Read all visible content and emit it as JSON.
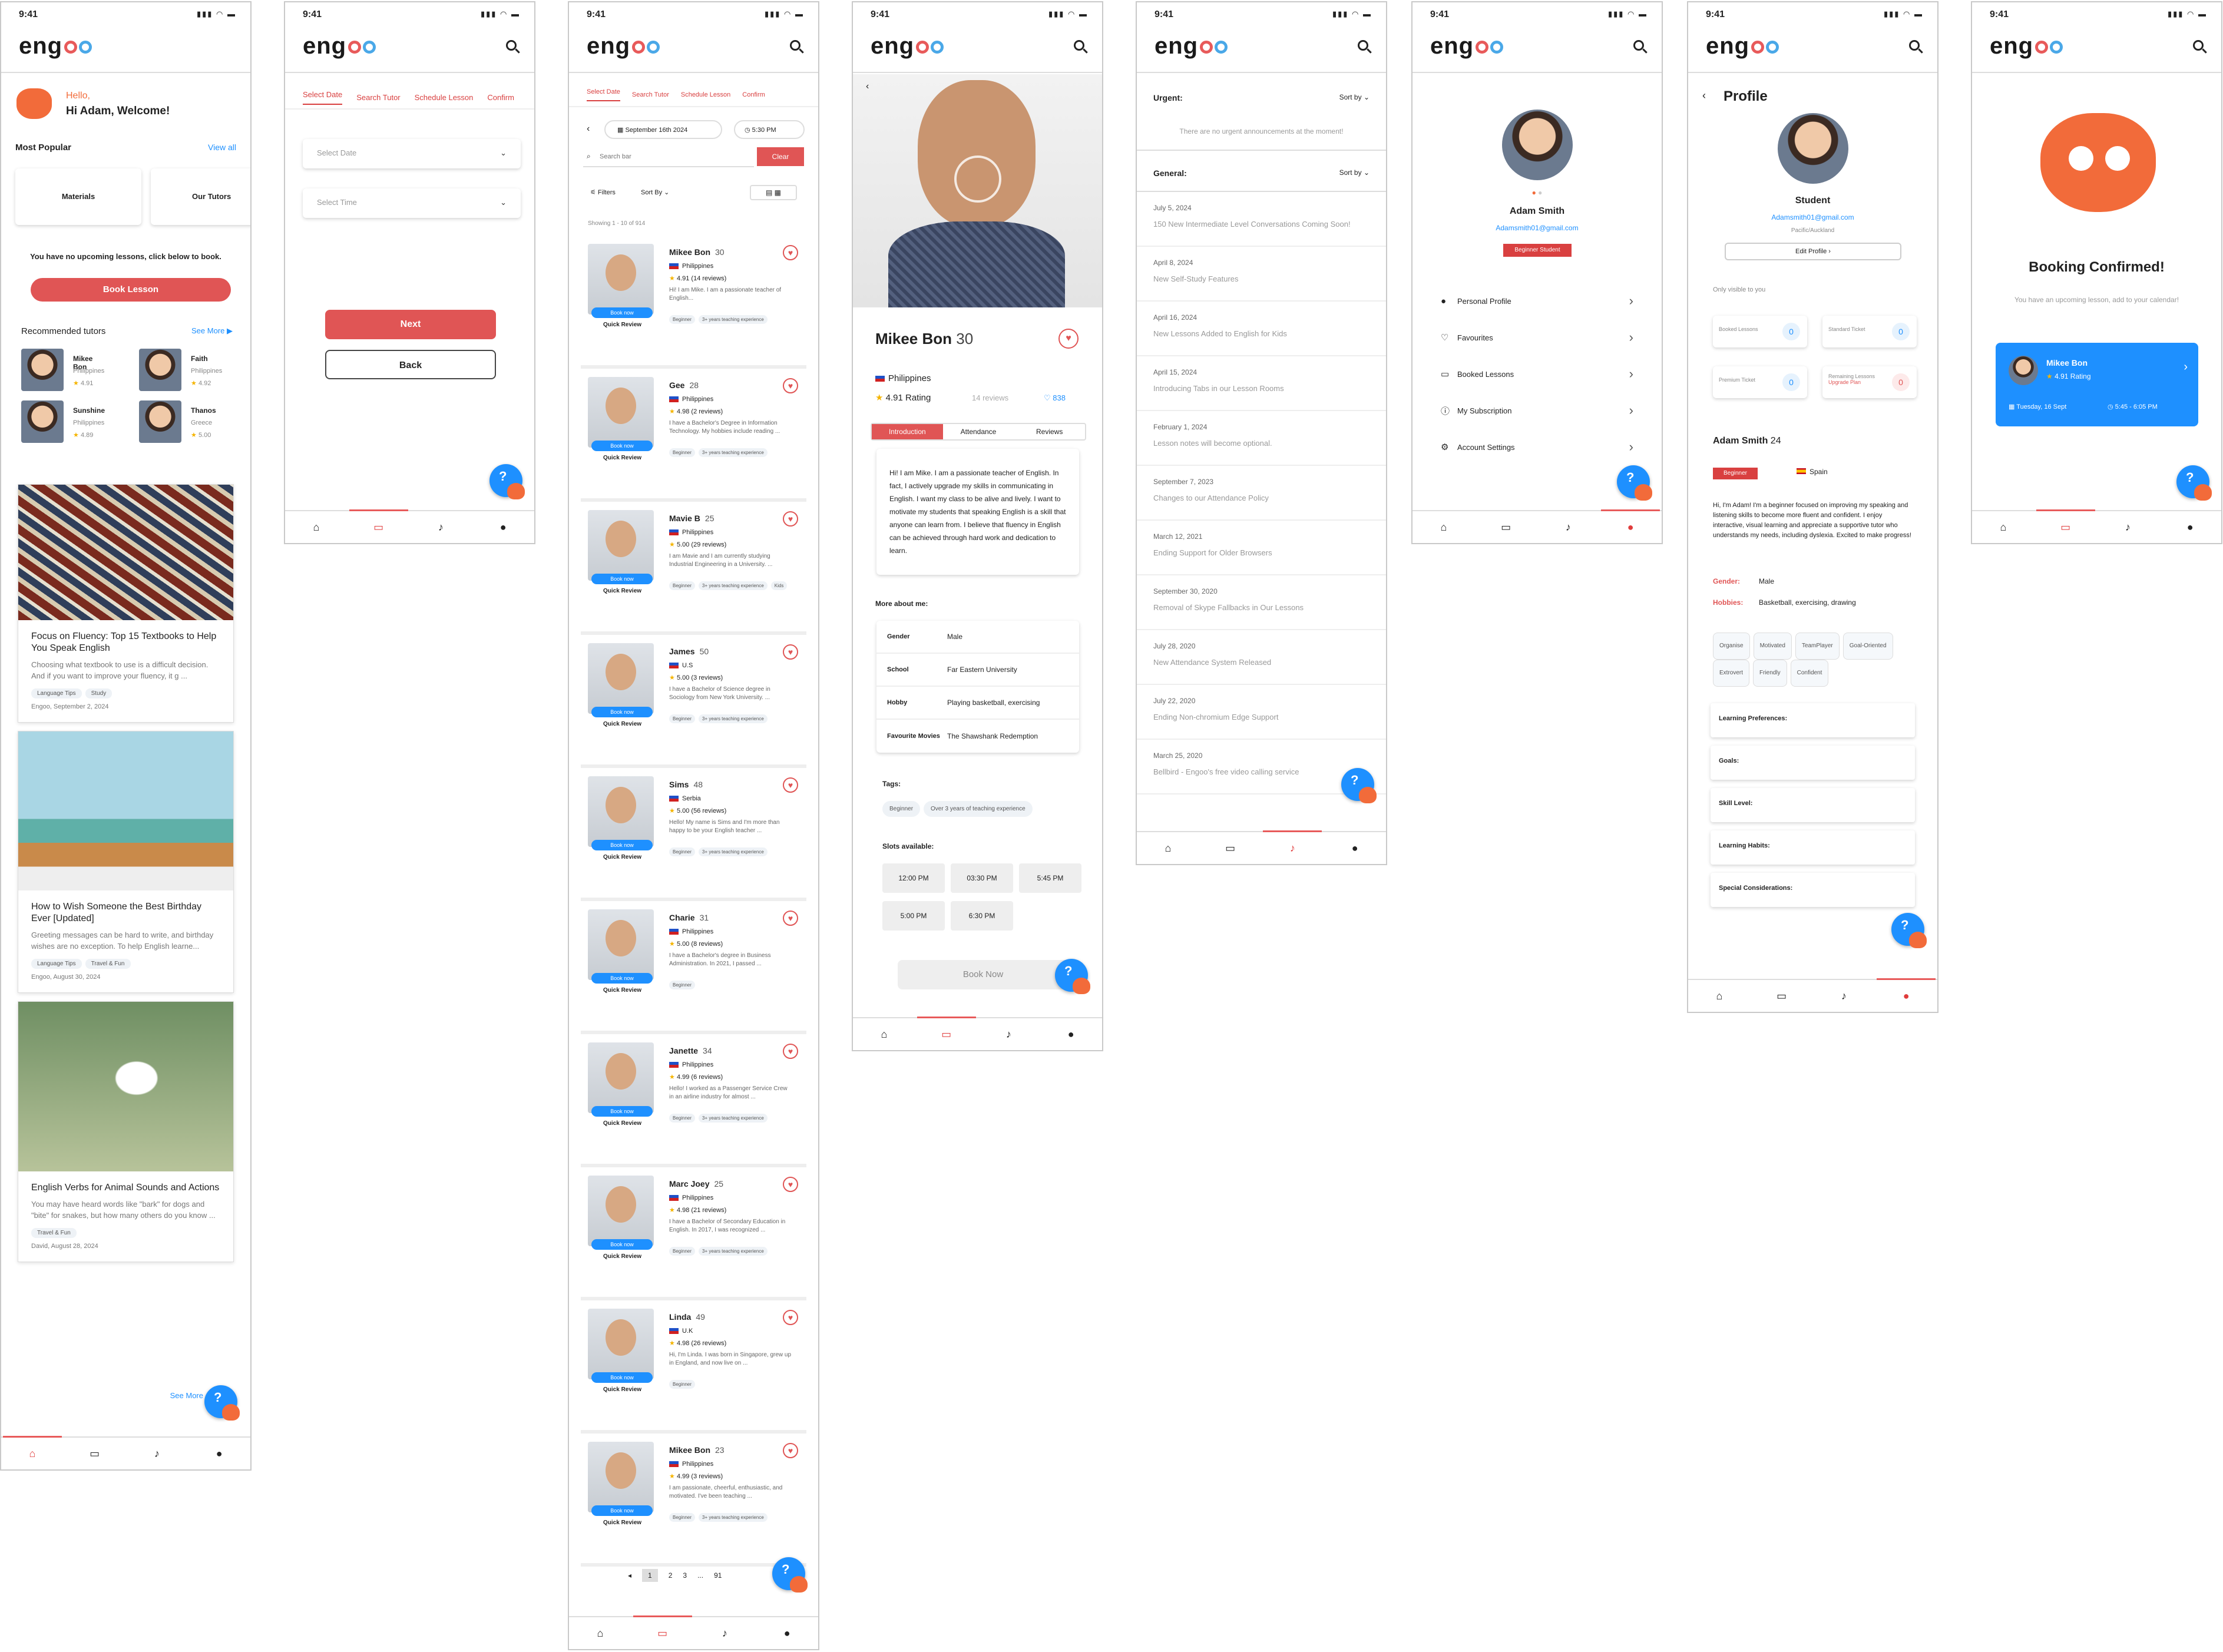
{
  "status": {
    "time": "9:41",
    "icons": "▮▮▮ ◠ ▬"
  },
  "logo": "engoo",
  "home": {
    "hello": "Hello,",
    "welcome": "Hi Adam, Welcome!",
    "most_popular": "Most Popular",
    "view_all": "View all",
    "materials": "Materials",
    "our_tutors": "Our Tutors",
    "no_lessons": "You have no upcoming lessons, click below to book.",
    "book_lesson": "Book Lesson",
    "recommended": "Recommended tutors",
    "see_more": "See More",
    "tutors": [
      {
        "name": "Mikee Bon",
        "country": "Philippines",
        "rating": "4.91"
      },
      {
        "name": "Faith",
        "country": "Philippines",
        "rating": "4.92"
      },
      {
        "name": "Sunshine",
        "country": "Philippines",
        "rating": "4.89"
      },
      {
        "name": "Thanos",
        "country": "Greece",
        "rating": "5.00"
      }
    ],
    "blogs": [
      {
        "title": "Focus on Fluency: Top 15 Textbooks to Help You Speak English",
        "text": "Choosing what textbook to use is a difficult decision. And if you want to improve your fluency, it g ...",
        "tags": [
          "Language Tips",
          "Study"
        ],
        "meta": "Engoo, September 2, 2024"
      },
      {
        "title": "How to Wish Someone the Best Birthday Ever [Updated]",
        "text": "Greeting messages can be hard to write, and birthday wishes are no exception. To help English learne...",
        "tags": [
          "Language Tips",
          "Travel & Fun"
        ],
        "meta": "Engoo, August 30, 2024"
      },
      {
        "title": "English Verbs for Animal Sounds and Actions",
        "text": "You may have heard words like \"bark\" for dogs and \"bite\" for snakes, but how many others do you know ...",
        "tags": [
          "Travel & Fun"
        ],
        "meta": "David, August 28, 2024"
      }
    ],
    "see_more_bottom": "See More"
  },
  "booking_tabs": [
    "Select Date",
    "Search Tutor",
    "Schedule Lesson",
    "Confirm"
  ],
  "select": {
    "date": "Select Date",
    "time": "Select Time",
    "next": "Next",
    "back": "Back"
  },
  "search": {
    "date": "September 16th 2024",
    "time": "5:30 PM",
    "placeholder": "Search bar",
    "clear": "Clear",
    "filters": "Filters",
    "sort": "Sort By",
    "showing": "Showing 1 - 10 of 914",
    "book_now": "Book now",
    "quick_review": "Quick Review",
    "tutors": [
      {
        "name": "Mikee Bon",
        "age": "30",
        "country": "Philippines",
        "rating": "4.91",
        "reviews": "(14 reviews)",
        "desc": "Hi! I am Mike. I am a passionate teacher of English...",
        "tags": [
          "Beginner",
          "3+ years teaching experience"
        ]
      },
      {
        "name": "Gee",
        "age": "28",
        "country": "Philippines",
        "rating": "4.98",
        "reviews": "(2 reviews)",
        "desc": "I have a Bachelor's Degree in Information Technology. My hobbies include reading ...",
        "tags": [
          "Beginner",
          "3+ years teaching experience"
        ]
      },
      {
        "name": "Mavie B",
        "age": "25",
        "country": "Philippines",
        "rating": "5.00",
        "reviews": "(29 reviews)",
        "desc": "I am Mavie and I am currently studying Industrial Engineering in a University. ...",
        "tags": [
          "Beginner",
          "3+ years teaching experience",
          "Kids"
        ]
      },
      {
        "name": "James",
        "age": "50",
        "country": "U.S",
        "rating": "5.00",
        "reviews": "(3 reviews)",
        "desc": "I have a Bachelor of Science degree in Sociology from New York University. ...",
        "tags": [
          "Beginner",
          "3+ years teaching experience"
        ]
      },
      {
        "name": "Sims",
        "age": "48",
        "country": "Serbia",
        "rating": "5.00",
        "reviews": "(56 reviews)",
        "desc": "Hello! My name is Sims and I'm more than happy to be your English teacher ...",
        "tags": [
          "Beginner",
          "3+ years teaching experience"
        ]
      },
      {
        "name": "Charie",
        "age": "31",
        "country": "Philippines",
        "rating": "5.00",
        "reviews": "(8 reviews)",
        "desc": "I have a Bachelor's degree in Business Administration. In 2021, I passed ...",
        "tags": [
          "Beginner"
        ]
      },
      {
        "name": "Janette",
        "age": "34",
        "country": "Philippines",
        "rating": "4.99",
        "reviews": "(6 reviews)",
        "desc": "Hello! I worked as a Passenger Service Crew in an airline industry for almost ...",
        "tags": [
          "Beginner",
          "3+ years teaching experience"
        ]
      },
      {
        "name": "Marc Joey",
        "age": "25",
        "country": "Philippines",
        "rating": "4.98",
        "reviews": "(21 reviews)",
        "desc": "I have a Bachelor of Secondary Education in English. In 2017, I was recognized ...",
        "tags": [
          "Beginner",
          "3+ years teaching experience"
        ]
      },
      {
        "name": "Linda",
        "age": "49",
        "country": "U.K",
        "rating": "4.98",
        "reviews": "(26 reviews)",
        "desc": "Hi, I'm Linda. I was born in Singapore, grew up in England, and now live on ...",
        "tags": [
          "Beginner"
        ]
      },
      {
        "name": "Mikee Bon",
        "age": "23",
        "country": "Philippines",
        "rating": "4.99",
        "reviews": "(3 reviews)",
        "desc": "I am passionate, cheerful, enthusiastic, and motivated. I've been teaching ...",
        "tags": [
          "Beginner",
          "3+ years teaching experience"
        ]
      }
    ],
    "pages": [
      "1",
      "2",
      "3",
      "...",
      "91"
    ]
  },
  "tutor": {
    "name": "Mikee Bon",
    "age": "30",
    "country": "Philippines",
    "rating": "4.91 Rating",
    "reviews": "14 reviews",
    "likes": "838",
    "tabs": [
      "Introduction",
      "Attendance",
      "Reviews"
    ],
    "intro": "Hi! I am Mike. I am a passionate teacher of English. In fact, I actively upgrade my skills in communicating in English. I want my class to be alive and lively. I want to motivate my students that speaking English is a skill that anyone can learn from. I believe that fluency in English can be achieved through hard work and dedication to learn.",
    "more_about": "More about me:",
    "about": [
      {
        "k": "Gender",
        "v": "Male"
      },
      {
        "k": "School",
        "v": "Far Eastern University"
      },
      {
        "k": "Hobby",
        "v": "Playing basketball, exercising"
      },
      {
        "k": "Favourite Movies",
        "v": "The Shawshank Redemption"
      }
    ],
    "tags_label": "Tags:",
    "tags": [
      "Beginner",
      "Over 3 years of teaching experience"
    ],
    "slots_label": "Slots available:",
    "slots": [
      "12:00 PM",
      "03:30 PM",
      "5:45 PM",
      "5:00 PM",
      "6:30 PM"
    ],
    "book_now": "Book Now"
  },
  "news": {
    "urgent": "Urgent:",
    "sort": "Sort by",
    "no_urgent": "There are no urgent announcements at the moment!",
    "general": "General:",
    "items": [
      {
        "d": "July 5, 2024",
        "t": "150 New Intermediate Level Conversations Coming Soon!"
      },
      {
        "d": "April 8, 2024",
        "t": "New Self-Study Features"
      },
      {
        "d": "April 16, 2024",
        "t": "New Lessons Added to English for Kids"
      },
      {
        "d": "April 15, 2024",
        "t": "Introducing Tabs in our Lesson Rooms"
      },
      {
        "d": "February 1, 2024",
        "t": "Lesson notes will become optional."
      },
      {
        "d": "September 7, 2023",
        "t": "Changes to our Attendance Policy"
      },
      {
        "d": "March 12, 2021",
        "t": "Ending Support for Older Browsers"
      },
      {
        "d": "September 30, 2020",
        "t": "Removal of Skype Fallbacks in Our Lessons"
      },
      {
        "d": "July 28, 2020",
        "t": "New Attendance System Released"
      },
      {
        "d": "July 22, 2020",
        "t": "Ending Non-chromium Edge Support"
      },
      {
        "d": "March 25, 2020",
        "t": "Bellbird - Engoo's free video calling service"
      }
    ]
  },
  "account": {
    "name": "Adam Smith",
    "email": "Adamsmith01@gmail.com",
    "level": "Beginner Student",
    "menu": [
      "Personal Profile",
      "Favourites",
      "Booked Lessons",
      "My Subscription",
      "Account Settings"
    ]
  },
  "profile": {
    "title": "Profile",
    "role": "Student",
    "email": "Adamsmith01@gmail.com",
    "location": "Pacific/Auckland",
    "edit": "Edit Profile",
    "visible": "Only visible to you",
    "tickets": [
      {
        "l": "Booked Lessons",
        "v": "0"
      },
      {
        "l": "Standard Ticket",
        "v": "0"
      },
      {
        "l": "Premium Ticket",
        "v": "0"
      },
      {
        "l": "Remaining Lessons",
        "v": "0",
        "s": "Upgrade Plan"
      }
    ],
    "name_age": "Adam Smith",
    "age": "24",
    "level": "Beginner",
    "lang": "Spain",
    "bio": "Hi, I'm Adam! I'm a beginner focused on improving my speaking and listening skills to become more fluent and confident. I enjoy interactive, visual learning and appreciate a supportive tutor who understands my needs, including dyslexia. Excited to make progress!",
    "gender_l": "Gender:",
    "gender": "Male",
    "hobbies_l": "Hobbies:",
    "hobbies": "Basketball, exercising, drawing",
    "traits": [
      "Organise",
      "Motivated",
      "TeamPlayer",
      "Goal-Oriented",
      "Extrovert",
      "Friendly",
      "Confident"
    ],
    "sections": [
      "Learning Preferences:",
      "Goals:",
      "Skill Level:",
      "Learning Habits:",
      "Special Considerations:"
    ]
  },
  "confirm": {
    "title": "Booking Confirmed!",
    "sub": "You have an upcoming lesson, add to your calendar!",
    "tutor": "Mikee Bon",
    "rating": "4.91 Rating",
    "date": "Tuesday, 16 Sept",
    "time": "5:45 - 6:05 PM"
  },
  "colors": {
    "accent": "#e05555",
    "blue": "#1e90ff",
    "mascot": "#f26b3a"
  }
}
